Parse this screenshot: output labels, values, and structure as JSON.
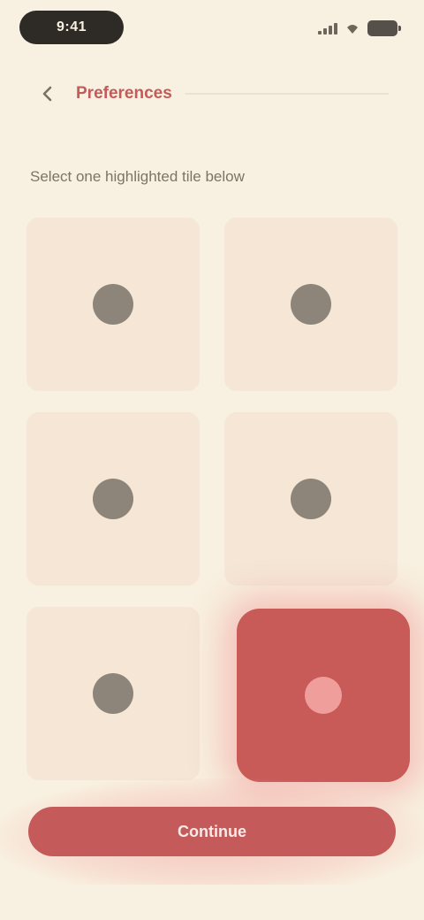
{
  "status_bar": {
    "time": "9:41"
  },
  "header": {
    "title": "Preferences"
  },
  "prompt": {
    "text": "Select one highlighted tile below"
  },
  "grid": {
    "tiles": [
      {
        "selected": false
      },
      {
        "selected": false
      },
      {
        "selected": false
      },
      {
        "selected": false
      },
      {
        "selected": false
      },
      {
        "selected": true
      }
    ]
  },
  "footer": {
    "continue_label": "Continue"
  },
  "colors": {
    "accent": "#c45a5a",
    "background": "#f8f0e0",
    "tile": "#f5e6d6",
    "tile_dot": "#8d857a",
    "selected_tile": "#c85a58"
  }
}
